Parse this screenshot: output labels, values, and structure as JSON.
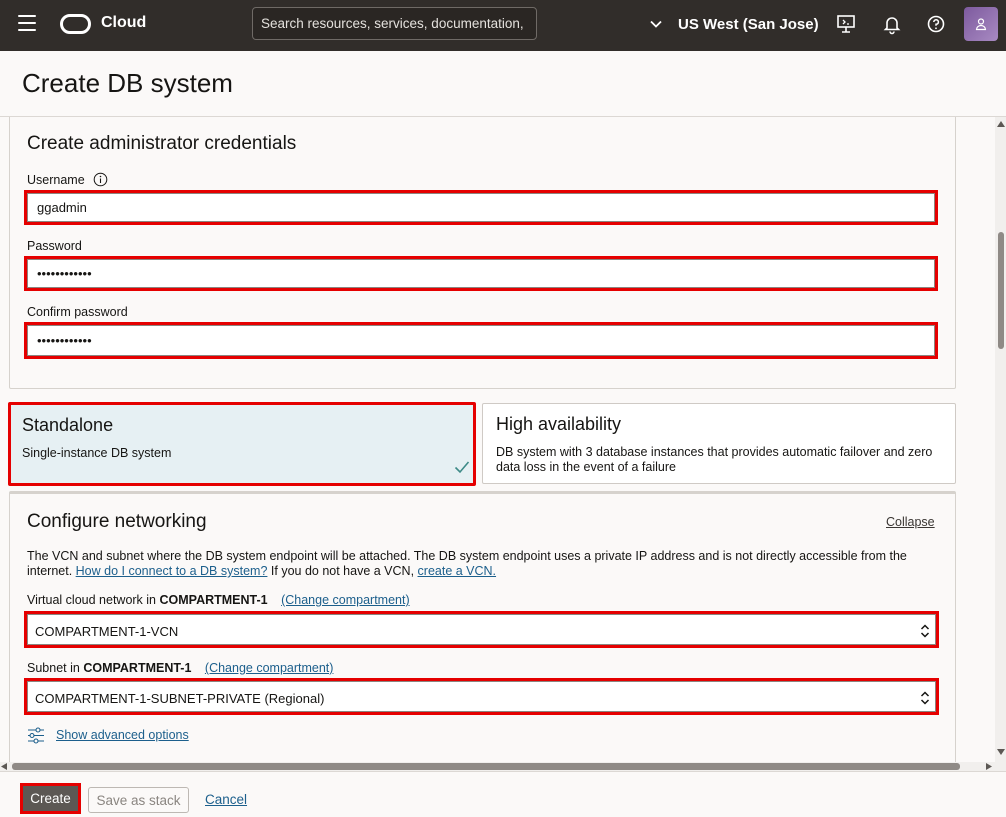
{
  "topbar": {
    "brand": "Cloud",
    "search_placeholder": "Search resources, services, documentation,",
    "region": "US West (San Jose)"
  },
  "page": {
    "title": "Create DB system"
  },
  "credentials": {
    "title": "Create administrator credentials",
    "username_label": "Username",
    "username_value": "ggadmin",
    "password_label": "Password",
    "password_value": "••••••••••••",
    "confirm_label": "Confirm password",
    "confirm_value": "••••••••••••"
  },
  "deployment": {
    "standalone": {
      "title": "Standalone",
      "desc": "Single-instance DB system",
      "selected": true
    },
    "ha": {
      "title": "High availability",
      "desc": "DB system with 3 database instances that provides automatic failover and zero data loss in the event of a failure",
      "selected": false
    }
  },
  "networking": {
    "title": "Configure networking",
    "collapse": "Collapse",
    "desc_pre": "The VCN and subnet where the DB system endpoint will be attached. The DB system endpoint uses a private IP address and is not directly accessible from the internet.",
    "desc_link1": "How do I connect to a DB system?",
    "desc_mid": "If you do not have a VCN,",
    "desc_link2": "create a VCN.",
    "vcn_label_pre": "Virtual cloud network in",
    "vcn_compartment": "COMPARTMENT-1",
    "change_compartment": "(Change compartment)",
    "vcn_value": "COMPARTMENT-1-VCN",
    "subnet_label_pre": "Subnet in",
    "subnet_compartment": "COMPARTMENT-1",
    "subnet_value": "COMPARTMENT-1-SUBNET-PRIVATE (Regional)",
    "advanced": "Show advanced options"
  },
  "footer": {
    "create": "Create",
    "save_stack": "Save as stack",
    "cancel": "Cancel"
  },
  "colors": {
    "topbar": "#312d2a",
    "highlight": "#e50000",
    "selected_tile": "#e6f0f3",
    "link": "#1c5f8c"
  }
}
